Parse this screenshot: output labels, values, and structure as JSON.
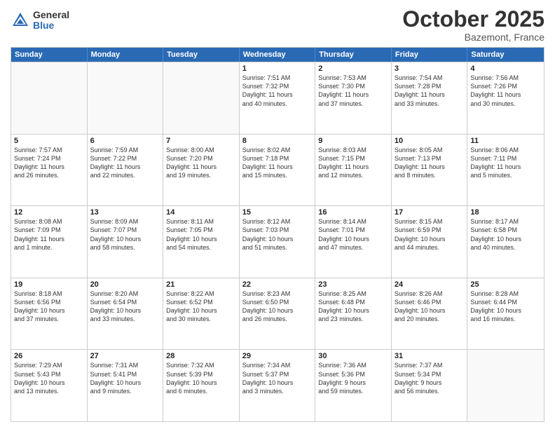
{
  "header": {
    "logo_general": "General",
    "logo_blue": "Blue",
    "month_title": "October 2025",
    "location": "Bazemont, France"
  },
  "days_of_week": [
    "Sunday",
    "Monday",
    "Tuesday",
    "Wednesday",
    "Thursday",
    "Friday",
    "Saturday"
  ],
  "weeks": [
    [
      {
        "day": "",
        "empty": true
      },
      {
        "day": "",
        "empty": true
      },
      {
        "day": "",
        "empty": true
      },
      {
        "day": "1",
        "lines": [
          "Sunrise: 7:51 AM",
          "Sunset: 7:32 PM",
          "Daylight: 11 hours",
          "and 40 minutes."
        ]
      },
      {
        "day": "2",
        "lines": [
          "Sunrise: 7:53 AM",
          "Sunset: 7:30 PM",
          "Daylight: 11 hours",
          "and 37 minutes."
        ]
      },
      {
        "day": "3",
        "lines": [
          "Sunrise: 7:54 AM",
          "Sunset: 7:28 PM",
          "Daylight: 11 hours",
          "and 33 minutes."
        ]
      },
      {
        "day": "4",
        "lines": [
          "Sunrise: 7:56 AM",
          "Sunset: 7:26 PM",
          "Daylight: 11 hours",
          "and 30 minutes."
        ]
      }
    ],
    [
      {
        "day": "5",
        "lines": [
          "Sunrise: 7:57 AM",
          "Sunset: 7:24 PM",
          "Daylight: 11 hours",
          "and 26 minutes."
        ]
      },
      {
        "day": "6",
        "lines": [
          "Sunrise: 7:59 AM",
          "Sunset: 7:22 PM",
          "Daylight: 11 hours",
          "and 22 minutes."
        ]
      },
      {
        "day": "7",
        "lines": [
          "Sunrise: 8:00 AM",
          "Sunset: 7:20 PM",
          "Daylight: 11 hours",
          "and 19 minutes."
        ]
      },
      {
        "day": "8",
        "lines": [
          "Sunrise: 8:02 AM",
          "Sunset: 7:18 PM",
          "Daylight: 11 hours",
          "and 15 minutes."
        ]
      },
      {
        "day": "9",
        "lines": [
          "Sunrise: 8:03 AM",
          "Sunset: 7:15 PM",
          "Daylight: 11 hours",
          "and 12 minutes."
        ]
      },
      {
        "day": "10",
        "lines": [
          "Sunrise: 8:05 AM",
          "Sunset: 7:13 PM",
          "Daylight: 11 hours",
          "and 8 minutes."
        ]
      },
      {
        "day": "11",
        "lines": [
          "Sunrise: 8:06 AM",
          "Sunset: 7:11 PM",
          "Daylight: 11 hours",
          "and 5 minutes."
        ]
      }
    ],
    [
      {
        "day": "12",
        "lines": [
          "Sunrise: 8:08 AM",
          "Sunset: 7:09 PM",
          "Daylight: 11 hours",
          "and 1 minute."
        ]
      },
      {
        "day": "13",
        "lines": [
          "Sunrise: 8:09 AM",
          "Sunset: 7:07 PM",
          "Daylight: 10 hours",
          "and 58 minutes."
        ]
      },
      {
        "day": "14",
        "lines": [
          "Sunrise: 8:11 AM",
          "Sunset: 7:05 PM",
          "Daylight: 10 hours",
          "and 54 minutes."
        ]
      },
      {
        "day": "15",
        "lines": [
          "Sunrise: 8:12 AM",
          "Sunset: 7:03 PM",
          "Daylight: 10 hours",
          "and 51 minutes."
        ]
      },
      {
        "day": "16",
        "lines": [
          "Sunrise: 8:14 AM",
          "Sunset: 7:01 PM",
          "Daylight: 10 hours",
          "and 47 minutes."
        ]
      },
      {
        "day": "17",
        "lines": [
          "Sunrise: 8:15 AM",
          "Sunset: 6:59 PM",
          "Daylight: 10 hours",
          "and 44 minutes."
        ]
      },
      {
        "day": "18",
        "lines": [
          "Sunrise: 8:17 AM",
          "Sunset: 6:58 PM",
          "Daylight: 10 hours",
          "and 40 minutes."
        ]
      }
    ],
    [
      {
        "day": "19",
        "lines": [
          "Sunrise: 8:18 AM",
          "Sunset: 6:56 PM",
          "Daylight: 10 hours",
          "and 37 minutes."
        ]
      },
      {
        "day": "20",
        "lines": [
          "Sunrise: 8:20 AM",
          "Sunset: 6:54 PM",
          "Daylight: 10 hours",
          "and 33 minutes."
        ]
      },
      {
        "day": "21",
        "lines": [
          "Sunrise: 8:22 AM",
          "Sunset: 6:52 PM",
          "Daylight: 10 hours",
          "and 30 minutes."
        ]
      },
      {
        "day": "22",
        "lines": [
          "Sunrise: 8:23 AM",
          "Sunset: 6:50 PM",
          "Daylight: 10 hours",
          "and 26 minutes."
        ]
      },
      {
        "day": "23",
        "lines": [
          "Sunrise: 8:25 AM",
          "Sunset: 6:48 PM",
          "Daylight: 10 hours",
          "and 23 minutes."
        ]
      },
      {
        "day": "24",
        "lines": [
          "Sunrise: 8:26 AM",
          "Sunset: 6:46 PM",
          "Daylight: 10 hours",
          "and 20 minutes."
        ]
      },
      {
        "day": "25",
        "lines": [
          "Sunrise: 8:28 AM",
          "Sunset: 6:44 PM",
          "Daylight: 10 hours",
          "and 16 minutes."
        ]
      }
    ],
    [
      {
        "day": "26",
        "lines": [
          "Sunrise: 7:29 AM",
          "Sunset: 5:43 PM",
          "Daylight: 10 hours",
          "and 13 minutes."
        ]
      },
      {
        "day": "27",
        "lines": [
          "Sunrise: 7:31 AM",
          "Sunset: 5:41 PM",
          "Daylight: 10 hours",
          "and 9 minutes."
        ]
      },
      {
        "day": "28",
        "lines": [
          "Sunrise: 7:32 AM",
          "Sunset: 5:39 PM",
          "Daylight: 10 hours",
          "and 6 minutes."
        ]
      },
      {
        "day": "29",
        "lines": [
          "Sunrise: 7:34 AM",
          "Sunset: 5:37 PM",
          "Daylight: 10 hours",
          "and 3 minutes."
        ]
      },
      {
        "day": "30",
        "lines": [
          "Sunrise: 7:36 AM",
          "Sunset: 5:36 PM",
          "Daylight: 9 hours",
          "and 59 minutes."
        ]
      },
      {
        "day": "31",
        "lines": [
          "Sunrise: 7:37 AM",
          "Sunset: 5:34 PM",
          "Daylight: 9 hours",
          "and 56 minutes."
        ]
      },
      {
        "day": "",
        "empty": true
      }
    ]
  ]
}
